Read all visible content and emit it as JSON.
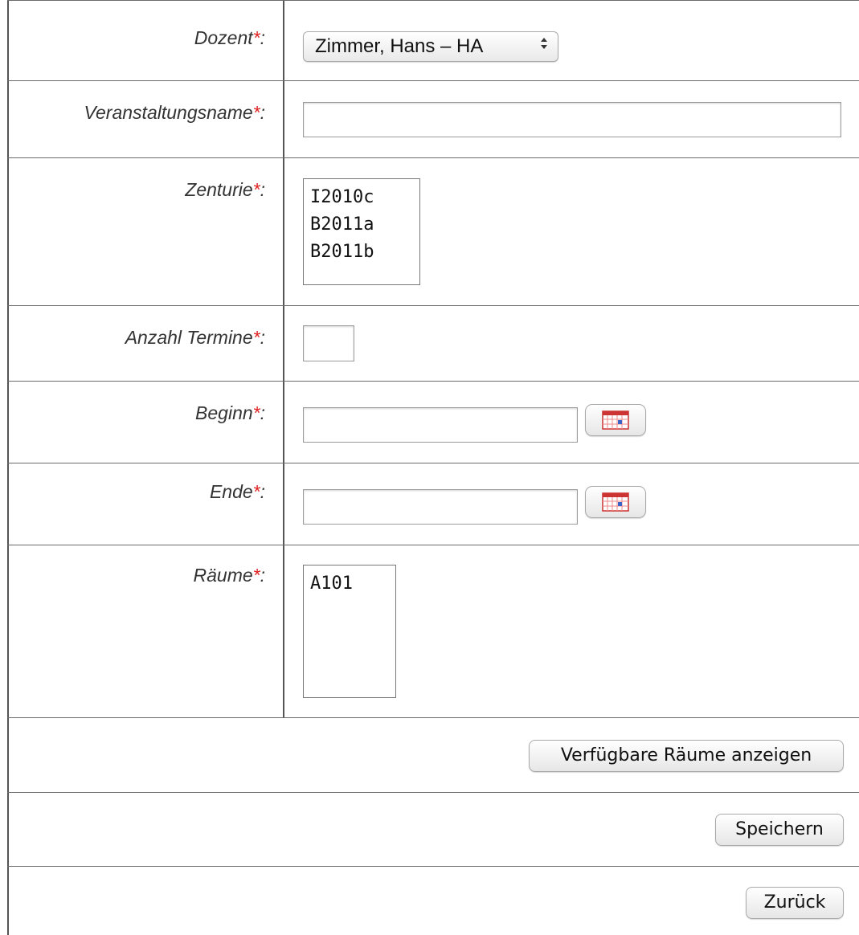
{
  "form": {
    "required_marker": "*",
    "dozent": {
      "label": "Dozent",
      "selected": "Zimmer, Hans – HA",
      "arrows_icon": "up-down-arrows-icon"
    },
    "veranstaltungsname": {
      "label": "Veranstaltungsname",
      "value": ""
    },
    "zenturie": {
      "label": "Zenturie",
      "options": [
        "I2010c",
        "B2011a",
        "B2011b"
      ]
    },
    "anzahl_termine": {
      "label": "Anzahl Termine",
      "value": ""
    },
    "beginn": {
      "label": "Beginn",
      "value": "",
      "icon": "calendar-icon"
    },
    "ende": {
      "label": "Ende",
      "value": "",
      "icon": "calendar-icon"
    },
    "raeume": {
      "label": "Räume",
      "options": [
        "A101"
      ]
    }
  },
  "buttons": {
    "show_rooms": "Verfügbare Räume anzeigen",
    "save": "Speichern",
    "back": "Zurück"
  },
  "colors": {
    "required": "#e02020",
    "border": "#555555"
  }
}
